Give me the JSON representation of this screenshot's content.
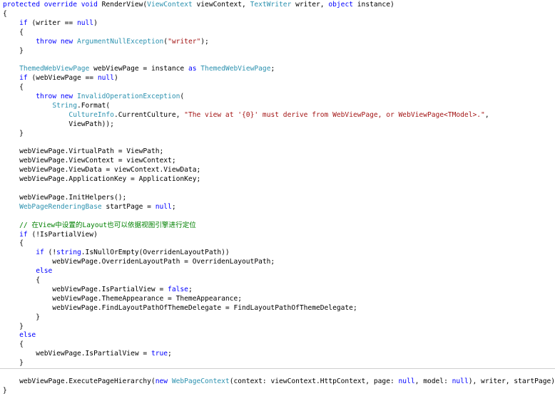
{
  "editor": {
    "lines": [
      [
        {
          "t": "protected override void",
          "k": "kw"
        },
        {
          "t": " RenderView("
        },
        {
          "t": "ViewContext",
          "k": "ty"
        },
        {
          "t": " viewContext, "
        },
        {
          "t": "TextWriter",
          "k": "ty"
        },
        {
          "t": " writer, "
        },
        {
          "t": "object",
          "k": "kw"
        },
        {
          "t": " instance)"
        }
      ],
      [
        {
          "t": "{"
        }
      ],
      [
        {
          "t": "    "
        },
        {
          "t": "if",
          "k": "kw"
        },
        {
          "t": " (writer == "
        },
        {
          "t": "null",
          "k": "kw"
        },
        {
          "t": ")"
        }
      ],
      [
        {
          "t": "    {"
        }
      ],
      [
        {
          "t": "        "
        },
        {
          "t": "throw new",
          "k": "kw"
        },
        {
          "t": " "
        },
        {
          "t": "ArgumentNullException",
          "k": "ty"
        },
        {
          "t": "("
        },
        {
          "t": "\"writer\"",
          "k": "str"
        },
        {
          "t": ");"
        }
      ],
      [
        {
          "t": "    }"
        }
      ],
      [],
      [
        {
          "t": "    "
        },
        {
          "t": "ThemedWebViewPage",
          "k": "ty"
        },
        {
          "t": " webViewPage = instance "
        },
        {
          "t": "as",
          "k": "kw"
        },
        {
          "t": " "
        },
        {
          "t": "ThemedWebViewPage",
          "k": "ty"
        },
        {
          "t": ";"
        }
      ],
      [
        {
          "t": "    "
        },
        {
          "t": "if",
          "k": "kw"
        },
        {
          "t": " (webViewPage == "
        },
        {
          "t": "null",
          "k": "kw"
        },
        {
          "t": ")"
        }
      ],
      [
        {
          "t": "    {"
        }
      ],
      [
        {
          "t": "        "
        },
        {
          "t": "throw new",
          "k": "kw"
        },
        {
          "t": " "
        },
        {
          "t": "InvalidOperationException",
          "k": "ty"
        },
        {
          "t": "("
        }
      ],
      [
        {
          "t": "            "
        },
        {
          "t": "String",
          "k": "ty"
        },
        {
          "t": ".Format("
        }
      ],
      [
        {
          "t": "                "
        },
        {
          "t": "CultureInfo",
          "k": "ty"
        },
        {
          "t": ".CurrentCulture, "
        },
        {
          "t": "\"The view at '{0}' must derive from WebViewPage, or WebViewPage<TModel>.\"",
          "k": "str"
        },
        {
          "t": ","
        }
      ],
      [
        {
          "t": "                ViewPath));"
        }
      ],
      [
        {
          "t": "    }"
        }
      ],
      [],
      [
        {
          "t": "    webViewPage.VirtualPath = ViewPath;"
        }
      ],
      [
        {
          "t": "    webViewPage.ViewContext = viewContext;"
        }
      ],
      [
        {
          "t": "    webViewPage.ViewData = viewContext.ViewData;"
        }
      ],
      [
        {
          "t": "    webViewPage.ApplicationKey = ApplicationKey;"
        }
      ],
      [],
      [
        {
          "t": "    webViewPage.InitHelpers();"
        }
      ],
      [
        {
          "t": "    "
        },
        {
          "t": "WebPageRenderingBase",
          "k": "ty"
        },
        {
          "t": " startPage = "
        },
        {
          "t": "null",
          "k": "kw"
        },
        {
          "t": ";"
        }
      ],
      [],
      [
        {
          "t": "    "
        },
        {
          "t": "// 在View中设置的Layout也可以依据视图引擎进行定位",
          "k": "cm"
        }
      ],
      [
        {
          "t": "    "
        },
        {
          "t": "if",
          "k": "kw"
        },
        {
          "t": " (!IsPartialView)"
        }
      ],
      [
        {
          "t": "    {"
        }
      ],
      [
        {
          "t": "        "
        },
        {
          "t": "if",
          "k": "kw"
        },
        {
          "t": " (!"
        },
        {
          "t": "string",
          "k": "kw"
        },
        {
          "t": ".IsNullOrEmpty(OverridenLayoutPath))"
        }
      ],
      [
        {
          "t": "            webViewPage.OverridenLayoutPath = OverridenLayoutPath;"
        }
      ],
      [
        {
          "t": "        "
        },
        {
          "t": "else",
          "k": "kw"
        }
      ],
      [
        {
          "t": "        {"
        }
      ],
      [
        {
          "t": "            webViewPage.IsPartialView = "
        },
        {
          "t": "false",
          "k": "kw"
        },
        {
          "t": ";"
        }
      ],
      [
        {
          "t": "            webViewPage.ThemeAppearance = ThemeAppearance;"
        }
      ],
      [
        {
          "t": "            webViewPage.FindLayoutPathOfThemeDelegate = FindLayoutPathOfThemeDelegate;"
        }
      ],
      [
        {
          "t": "        }"
        }
      ],
      [
        {
          "t": "    }"
        }
      ],
      [
        {
          "t": "    "
        },
        {
          "t": "else",
          "k": "kw"
        }
      ],
      [
        {
          "t": "    {"
        }
      ],
      [
        {
          "t": "        webViewPage.IsPartialView = "
        },
        {
          "t": "true",
          "k": "kw"
        },
        {
          "t": ";"
        }
      ],
      [
        {
          "t": "    }"
        }
      ],
      [],
      [
        {
          "t": "    webViewPage.ExecutePageHierarchy("
        },
        {
          "t": "new",
          "k": "kw"
        },
        {
          "t": " "
        },
        {
          "t": "WebPageContext",
          "k": "ty"
        },
        {
          "t": "(context: viewContext.HttpContext, page: "
        },
        {
          "t": "null",
          "k": "kw"
        },
        {
          "t": ", model: "
        },
        {
          "t": "null",
          "k": "kw"
        },
        {
          "t": "), writer, startPage);"
        }
      ],
      [
        {
          "t": "}"
        }
      ]
    ]
  }
}
